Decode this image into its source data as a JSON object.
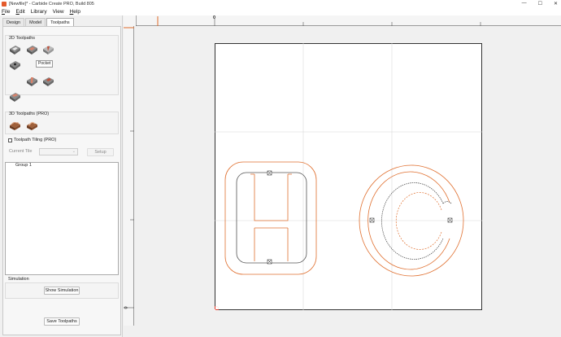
{
  "window": {
    "title": "[Newfile]* - Carbide Create PRO, Build 805",
    "controls": [
      "—",
      "☐",
      "✕"
    ]
  },
  "menu": [
    {
      "label": "File",
      "mnemonic": "F",
      "rest": "ile"
    },
    {
      "label": "Edit",
      "mnemonic": "E",
      "rest": "dit"
    },
    {
      "label": "Library",
      "mnemonic": "",
      "rest": "Library"
    },
    {
      "label": "View",
      "mnemonic": "",
      "rest": "View"
    },
    {
      "label": "Help",
      "mnemonic": "H",
      "rest": "elp"
    }
  ],
  "tabs": [
    {
      "label": "Design",
      "active": false
    },
    {
      "label": "Model",
      "active": false
    },
    {
      "label": "Toolpaths",
      "active": true
    }
  ],
  "toolpaths_2d": {
    "title": "2D Toolpaths",
    "tooltip": "Pocket",
    "tools": [
      "contour-toolpath-icon",
      "pocket-toolpath-icon",
      "v-carve-toolpath-icon",
      "drill-toolpath-icon",
      "advanced-vcarve-toolpath-icon",
      "texture-toolpath-icon",
      "chamfer-toolpath-icon"
    ]
  },
  "toolpaths_3d": {
    "title": "3D Toolpaths (PRO)",
    "tools": [
      "3d-rough-toolpath-icon",
      "3d-finish-toolpath-icon"
    ]
  },
  "tiling": {
    "checkbox_label": "Toolpath Tiling (PRO)",
    "checked": false,
    "current_tile_label": "Current Tile",
    "current_tile_value": "",
    "setup_label": "Setup"
  },
  "groups": {
    "items": [
      "Group 1"
    ]
  },
  "simulation": {
    "title": "Simulation",
    "show_label": "Show Simulation"
  },
  "save_label": "Save Toolpaths",
  "rulers": {
    "top_zero": "0",
    "left_zero": "0"
  },
  "colors": {
    "accent": "#e06a2c",
    "path": "#e07030",
    "path_inner": "#555555",
    "grid": "#d8d8d8"
  }
}
